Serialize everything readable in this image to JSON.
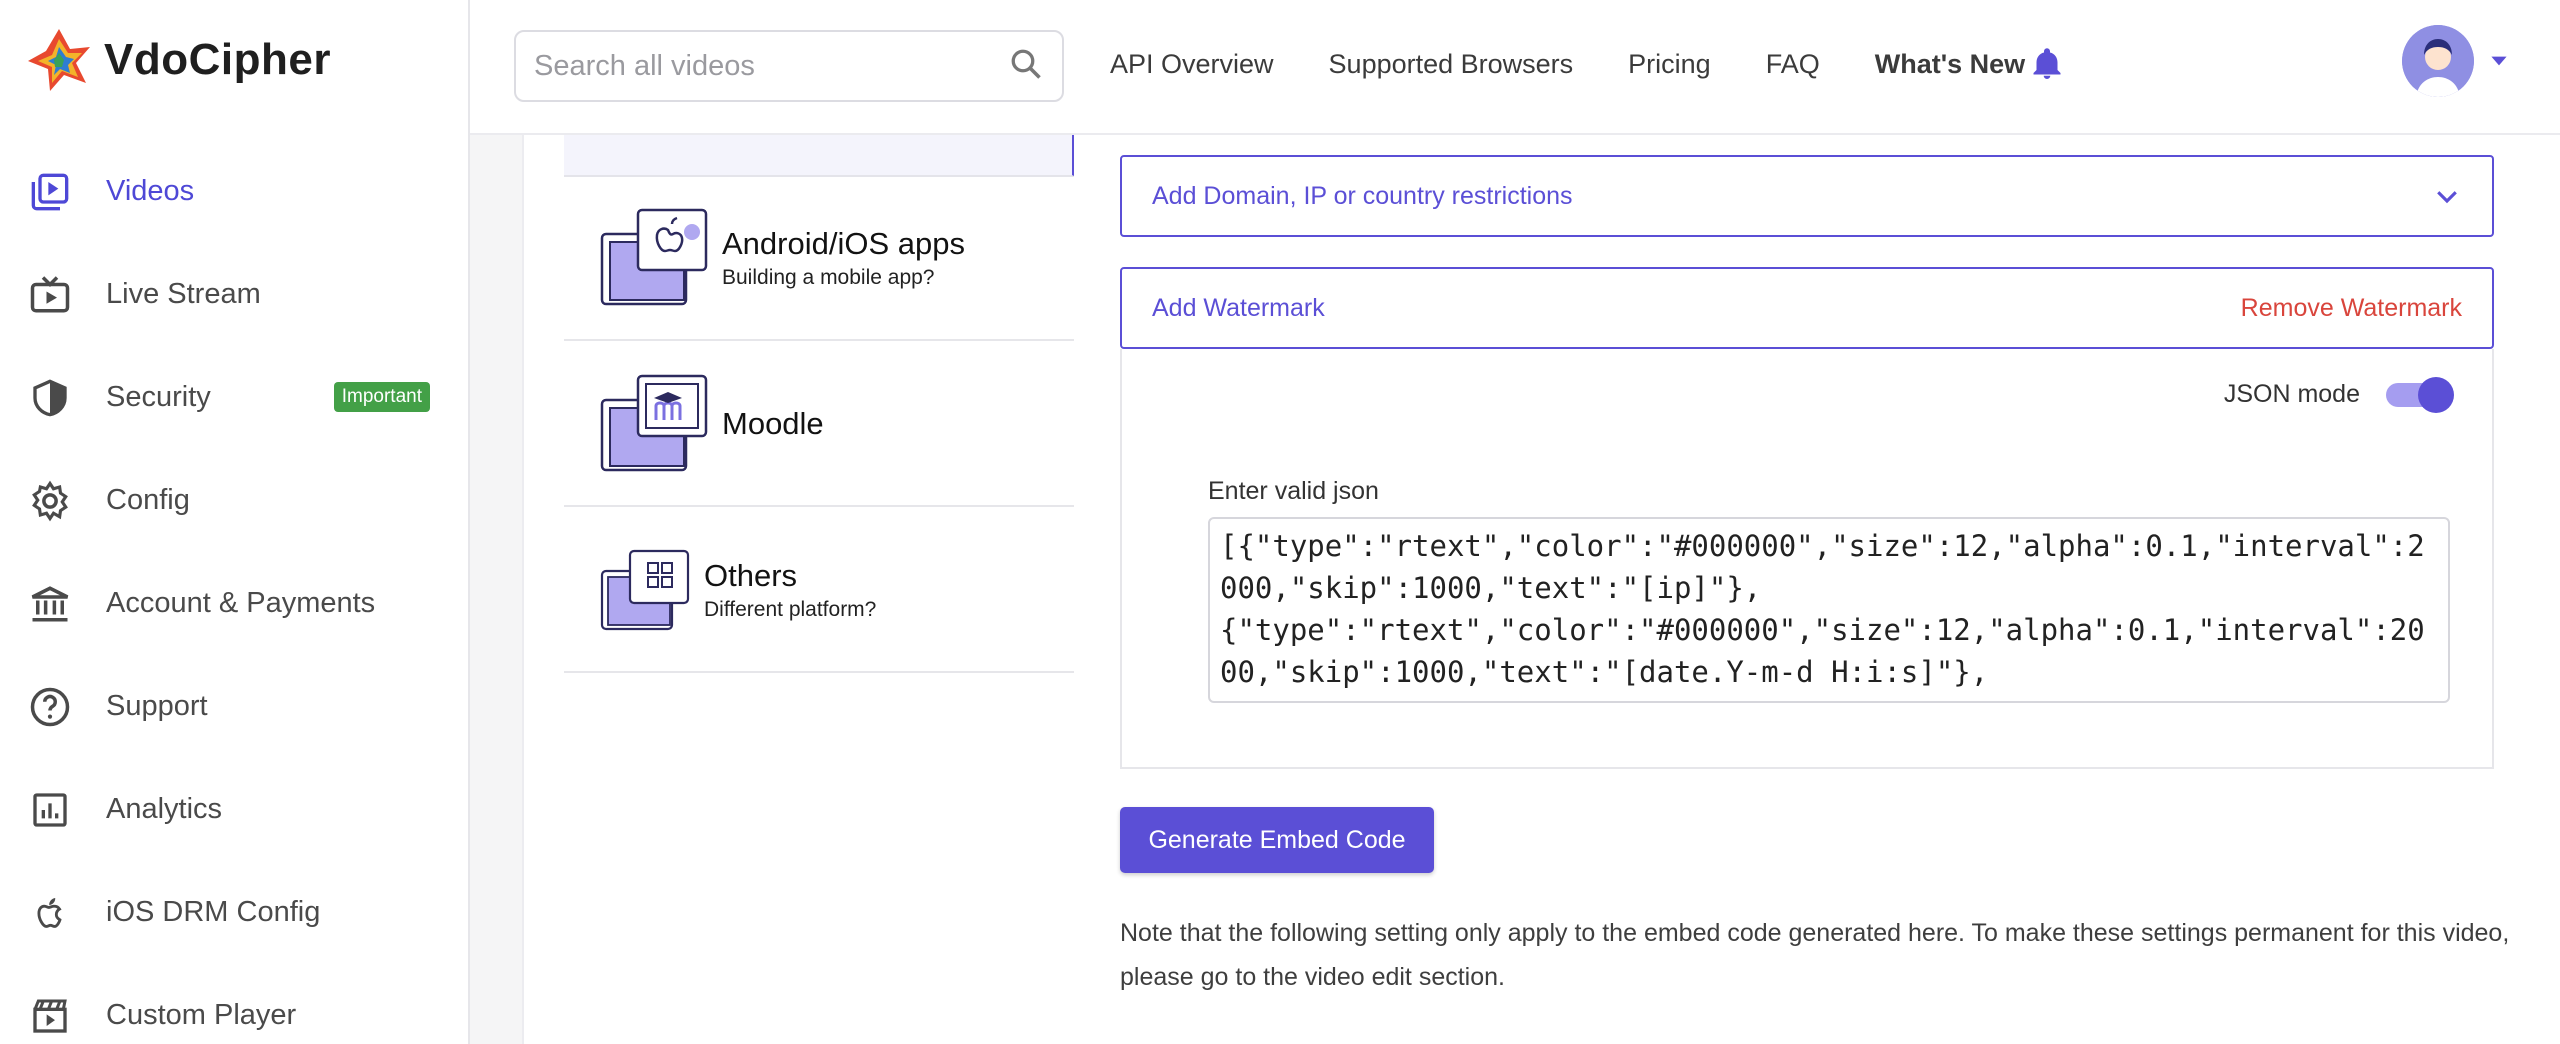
{
  "brand": {
    "name": "VdoCipher"
  },
  "sidebar": {
    "items": [
      {
        "label": "Videos",
        "icon": "video-library-icon",
        "active": true
      },
      {
        "label": "Live Stream",
        "icon": "live-tv-icon"
      },
      {
        "label": "Security",
        "icon": "shield-icon",
        "badge": "Important"
      },
      {
        "label": "Config",
        "icon": "gear-icon"
      },
      {
        "label": "Account & Payments",
        "icon": "bank-icon"
      },
      {
        "label": "Support",
        "icon": "help-circle-icon"
      },
      {
        "label": "Analytics",
        "icon": "analytics-icon"
      },
      {
        "label": "iOS DRM Config",
        "icon": "apple-icon"
      },
      {
        "label": "Custom Player",
        "icon": "clapperboard-icon"
      }
    ]
  },
  "header": {
    "search_placeholder": "Search all videos",
    "links": [
      "API Overview",
      "Supported Browsers",
      "Pricing",
      "FAQ"
    ],
    "whats_new": "What's New"
  },
  "platforms": [
    {
      "title": "Android/iOS apps",
      "subtitle": "Building a mobile app?",
      "icon": "mobile-app-icon"
    },
    {
      "title": "Moodle",
      "subtitle": "",
      "icon": "moodle-icon"
    },
    {
      "title": "Others",
      "subtitle": "Different platform?",
      "icon": "grid-icon"
    }
  ],
  "restrictions": {
    "label": "Add Domain, IP or country restrictions"
  },
  "watermark": {
    "add_label": "Add Watermark",
    "remove_label": "Remove Watermark",
    "json_mode_label": "JSON mode",
    "json_mode_on": true,
    "json_label": "Enter valid json",
    "json_value": "[{\"type\":\"rtext\",\"color\":\"#000000\",\"size\":12,\"alpha\":0.1,\"interval\":2000,\"skip\":1000,\"text\":\"[ip]\"},\n{\"type\":\"rtext\",\"color\":\"#000000\",\"size\":12,\"alpha\":0.1,\"interval\":2000,\"skip\":1000,\"text\":\"[date.Y-m-d H:i:s]\"},"
  },
  "generate_button": "Generate Embed Code",
  "note": "Note that the following setting only apply to the embed code generated here. To make these settings permanent for this video, please go to the video edit section.",
  "colors": {
    "accent": "#5b4fd6",
    "danger": "#d9453c",
    "badge": "#43a047"
  }
}
